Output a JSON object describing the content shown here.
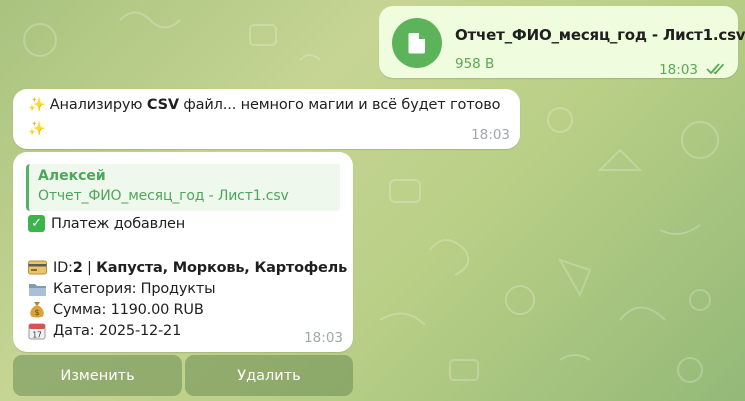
{
  "file_message": {
    "name": "Отчет_ФИО_месяц_год - Лист1.csv",
    "size": "958 B",
    "time": "18:03",
    "icon": "file-icon",
    "status_icon": "double-check-icon"
  },
  "bot_message": {
    "sparkle": "✨",
    "text_before": " Анализирую ",
    "text_bold": "CSV",
    "text_after": " файл... немного магии и всё будет готово",
    "time": "18:03"
  },
  "payment_card": {
    "reply": {
      "author": "Алексей",
      "file": "Отчет_ФИО_месяц_год - Лист1.csv"
    },
    "status": "Платеж добавлен",
    "id_label": "ID: ",
    "id_value": "2",
    "separator": " | ",
    "items": "Капуста, Морковь, Картофель",
    "category": "Категория: Продукты",
    "amount": "Сумма: 1190.00 RUB",
    "date": "Дата: 2025-12-21",
    "time": "18:03"
  },
  "keyboard": {
    "edit_label": "Изменить",
    "delete_label": "Удалить"
  },
  "colors": {
    "outgoing_bubble": "#effdde",
    "incoming_bubble": "#ffffff",
    "accent_green": "#4ea65a",
    "file_icon_bg": "#5db35a"
  }
}
